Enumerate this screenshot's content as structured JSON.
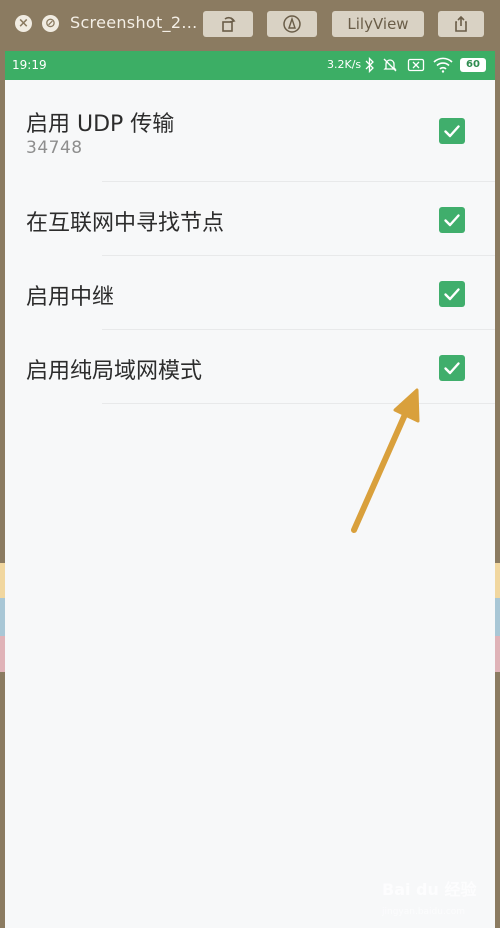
{
  "titlebar": {
    "title": "Screenshot_2...",
    "app_button": "LilyView",
    "close_icon": "close-circle-icon",
    "stop_icon": "no-entry-icon",
    "rotate_icon": "rotate-icon",
    "markup_icon": "markup-pen-icon",
    "share_icon": "share-icon"
  },
  "statusbar": {
    "time": "19:19",
    "speed": "3.2K/s",
    "battery": "60"
  },
  "settings": {
    "items": [
      {
        "title": "启用 UDP 传输",
        "subtitle": "34748",
        "checked": true
      },
      {
        "title": "在互联网中寻找节点",
        "checked": true
      },
      {
        "title": "启用中继",
        "checked": true
      },
      {
        "title": "启用纯局域网模式",
        "checked": true
      }
    ]
  },
  "annotation": {
    "arrow_color": "#d9a03c"
  },
  "colors": {
    "statusbar": "#3cae65",
    "checkbox": "#40ae6c",
    "window_frame": "#8b7b61"
  },
  "watermark": {
    "text": "Bai du 经验",
    "sub": "jingyan.baidu.com"
  }
}
